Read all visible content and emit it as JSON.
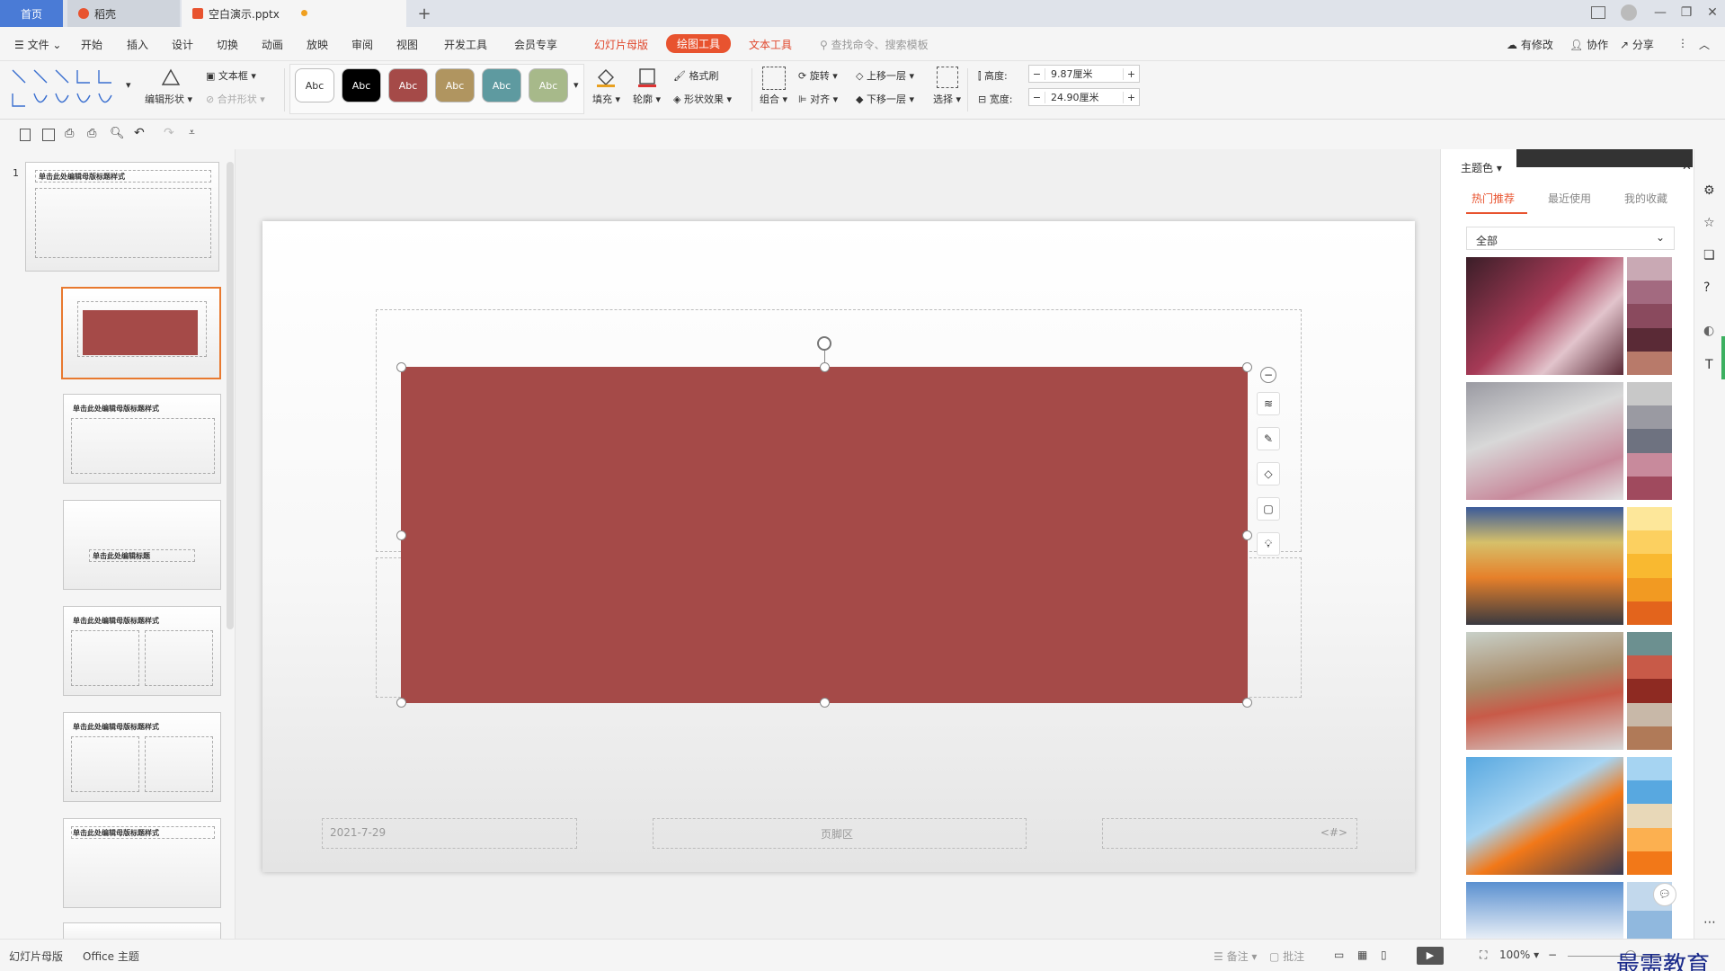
{
  "tabs": {
    "home": "首页",
    "daoke": "稻壳",
    "doc": "空白演示.pptx",
    "add": "+"
  },
  "window": {
    "minimize": "—",
    "restore": "❐",
    "close": "✕"
  },
  "menu": {
    "file": "文件",
    "items": [
      "开始",
      "插入",
      "设计",
      "切换",
      "动画",
      "放映",
      "审阅",
      "视图",
      "开发工具",
      "会员专享"
    ],
    "slide_master": "幻灯片母版",
    "drawing_tools": "绘图工具",
    "text_tools": "文本工具",
    "search": "查找命令、搜索模板",
    "modified": "有修改",
    "collab": "协作",
    "share": "分享"
  },
  "ribbon": {
    "edit_shape": "编辑形状",
    "textbox": "文本框",
    "merge_shape": "合并形状",
    "style_label": "Abc",
    "styles": [
      {
        "bg": "#ffffff",
        "fg": "#333333"
      },
      {
        "bg": "#000000",
        "fg": "#ffffff"
      },
      {
        "bg": "#a54a48",
        "fg": "#ffffff"
      },
      {
        "bg": "#b09560",
        "fg": "#ffffff"
      },
      {
        "bg": "#5e9aa0",
        "fg": "#ffffff"
      },
      {
        "bg": "#a7b98a",
        "fg": "#ffffff"
      }
    ],
    "fill": "填充",
    "outline": "轮廓",
    "format_painter": "格式刷",
    "shape_effect": "形状效果",
    "group": "组合",
    "rotate": "旋转",
    "align": "对齐",
    "bring_forward": "上移一层",
    "send_backward": "下移一层",
    "select": "选择",
    "height_label": "高度:",
    "height_value": "9.87厘米",
    "width_label": "宽度:",
    "width_value": "24.90厘米"
  },
  "thumbs": {
    "number": "1",
    "master_title": "单击此处编辑母版标题样式",
    "layout_title": "单击此处编辑标题"
  },
  "slide": {
    "date": "2021-7-29",
    "footer": "页脚区",
    "page": "<#>",
    "shape_color": "#a54a48"
  },
  "right_panel": {
    "title": "主题色",
    "tab_hot": "热门推荐",
    "tab_recent": "最近使用",
    "tab_fav": "我的收藏",
    "filter": "全部",
    "palettes": [
      [
        "#c9a9b4",
        "#a36a80",
        "#8a4a5e",
        "#5a2a36",
        "#b87a6a"
      ],
      [
        "#c8c8c8",
        "#9a9aa2",
        "#6e7280",
        "#c88a9c",
        "#a04a5e"
      ],
      [
        "#fde79a",
        "#fcd060",
        "#f9b930",
        "#f29a22",
        "#e3641c"
      ],
      [
        "#6c9090",
        "#c85a48",
        "#8e2a22",
        "#c8b8a8",
        "#b07a58"
      ],
      [
        "#a6d4f2",
        "#58a8e0",
        "#e8d8b8",
        "#fcb050",
        "#f27818"
      ],
      [
        "#c2d8ec",
        "#90b8de"
      ]
    ]
  },
  "status": {
    "mode": "幻灯片母版",
    "theme": "Office 主题",
    "notes": "备注",
    "comments": "批注",
    "zoom": "100%"
  },
  "watermark": "最需教育"
}
